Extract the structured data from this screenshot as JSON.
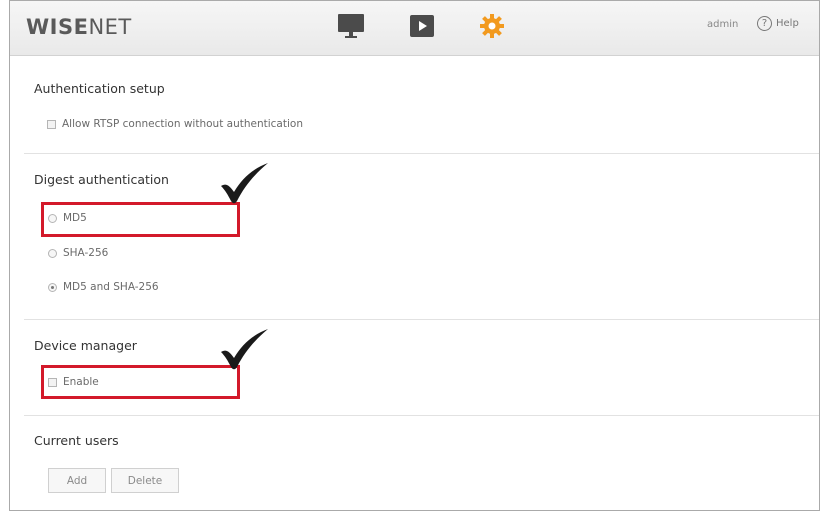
{
  "header": {
    "logo_part1": "WISE",
    "logo_part2": "NET",
    "nav_icons": [
      "monitor-icon",
      "play-icon",
      "gear-icon"
    ],
    "active_nav": "gear-icon",
    "active_color": "#f29a1f",
    "user": "admin",
    "help_label": "Help"
  },
  "auth_setup": {
    "title": "Authentication setup",
    "options": [
      {
        "label": "Allow RTSP connection without authentication",
        "checked": false
      }
    ]
  },
  "digest": {
    "title": "Digest authentication",
    "options": [
      {
        "label": "MD5",
        "selected": false
      },
      {
        "label": "SHA-256",
        "selected": false
      },
      {
        "label": "MD5 and SHA-256",
        "selected": true
      }
    ]
  },
  "device_manager": {
    "title": "Device manager",
    "enable_label": "Enable",
    "enabled": false
  },
  "current_users": {
    "title": "Current users",
    "add_label": "Add",
    "delete_label": "Delete"
  },
  "annotation": {
    "highlight_color": "#d3192a"
  }
}
